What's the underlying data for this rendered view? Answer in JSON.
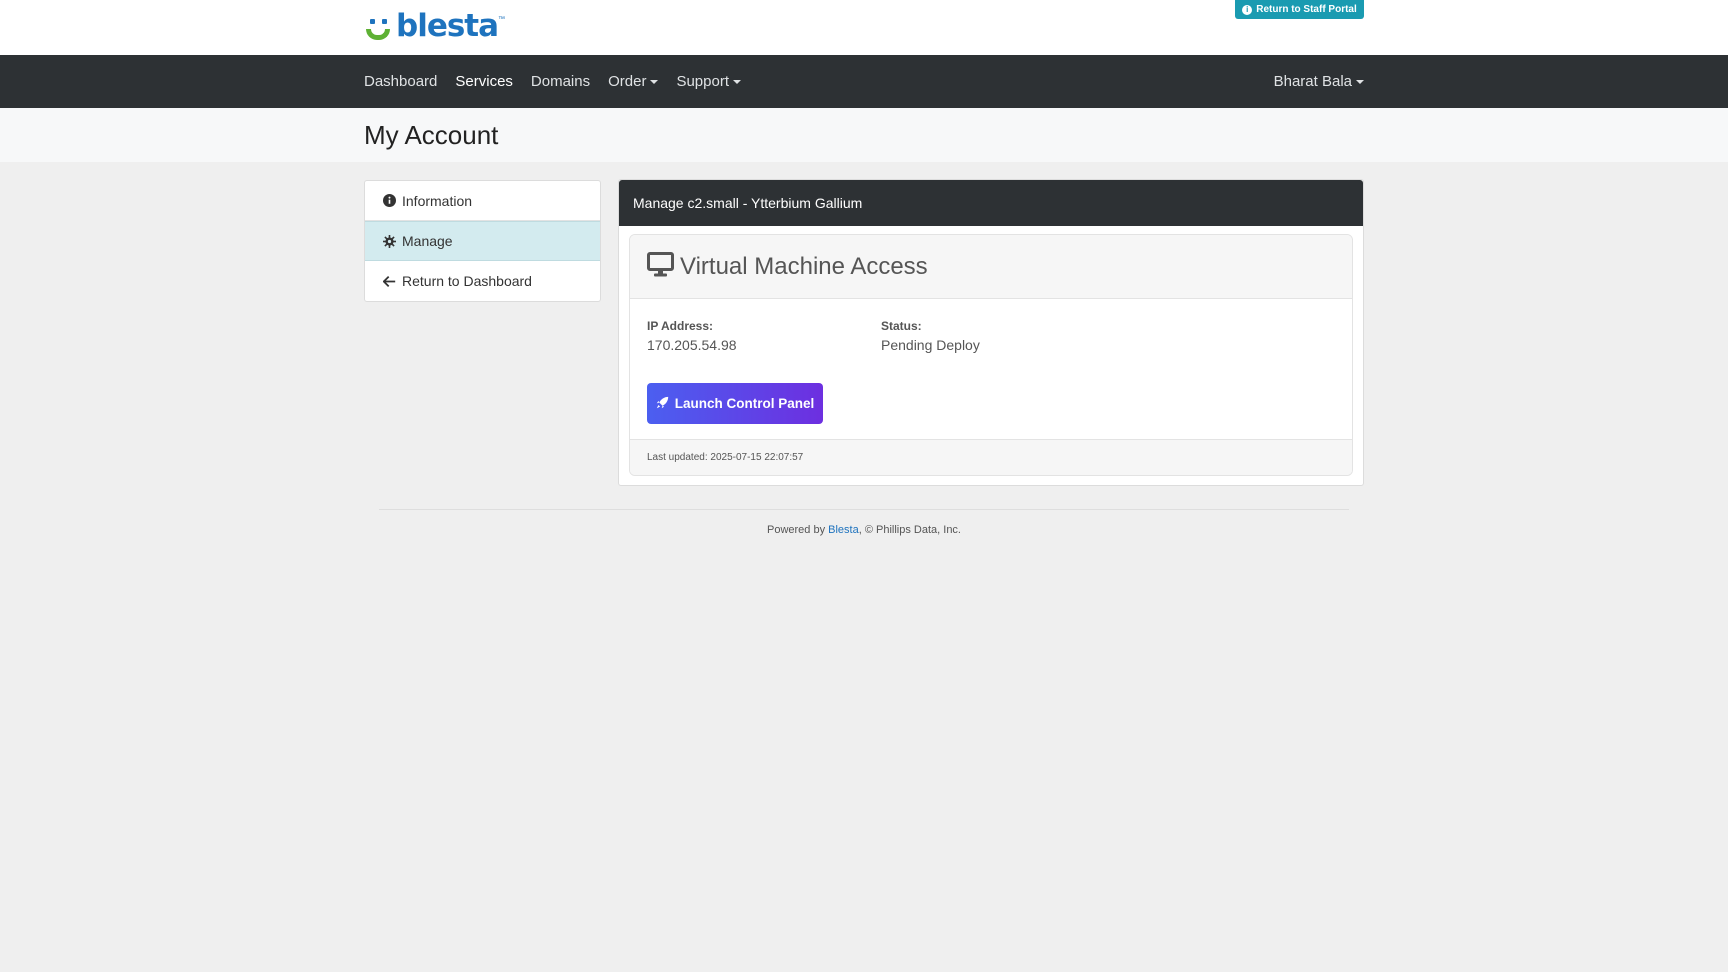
{
  "brand": {
    "name": "blesta",
    "tm": "™",
    "colors": {
      "blue": "#1e73be",
      "green": "#5eb134"
    }
  },
  "staff_portal": {
    "label": "Return to Staff Portal",
    "icon": "info-circle-icon",
    "color": "#1a9bb1"
  },
  "nav": {
    "items": [
      {
        "label": "Dashboard",
        "active": false,
        "dropdown": false
      },
      {
        "label": "Services",
        "active": true,
        "dropdown": false
      },
      {
        "label": "Domains",
        "active": false,
        "dropdown": false
      },
      {
        "label": "Order",
        "active": false,
        "dropdown": true
      },
      {
        "label": "Support",
        "active": false,
        "dropdown": true
      }
    ],
    "user": "Bharat Bala",
    "background": "#2d3134"
  },
  "page": {
    "title": "My Account"
  },
  "sidebar": {
    "items": [
      {
        "label": "Information",
        "icon": "info-circle-icon",
        "active": false
      },
      {
        "label": "Manage",
        "icon": "gear-icon",
        "active": true
      },
      {
        "label": "Return to Dashboard",
        "icon": "arrow-left-icon",
        "active": false
      }
    ]
  },
  "panel": {
    "header": "Manage c2.small - Ytterbium Gallium",
    "card": {
      "title": "Virtual Machine Access",
      "icon": "monitor-icon",
      "ip_label": "IP Address:",
      "ip_value": "170.205.54.98",
      "status_label": "Status:",
      "status_value": "Pending Deploy",
      "launch_label": "Launch Control Panel",
      "launch_icon": "rocket-icon",
      "gradient": [
        "#4b5ff0",
        "#6d2fe0"
      ],
      "last_updated": "Last updated: 2025-07-15 22:07:57"
    }
  },
  "footer": {
    "prefix": "Powered by ",
    "link": "Blesta",
    "suffix": ", © Phillips Data, Inc."
  }
}
